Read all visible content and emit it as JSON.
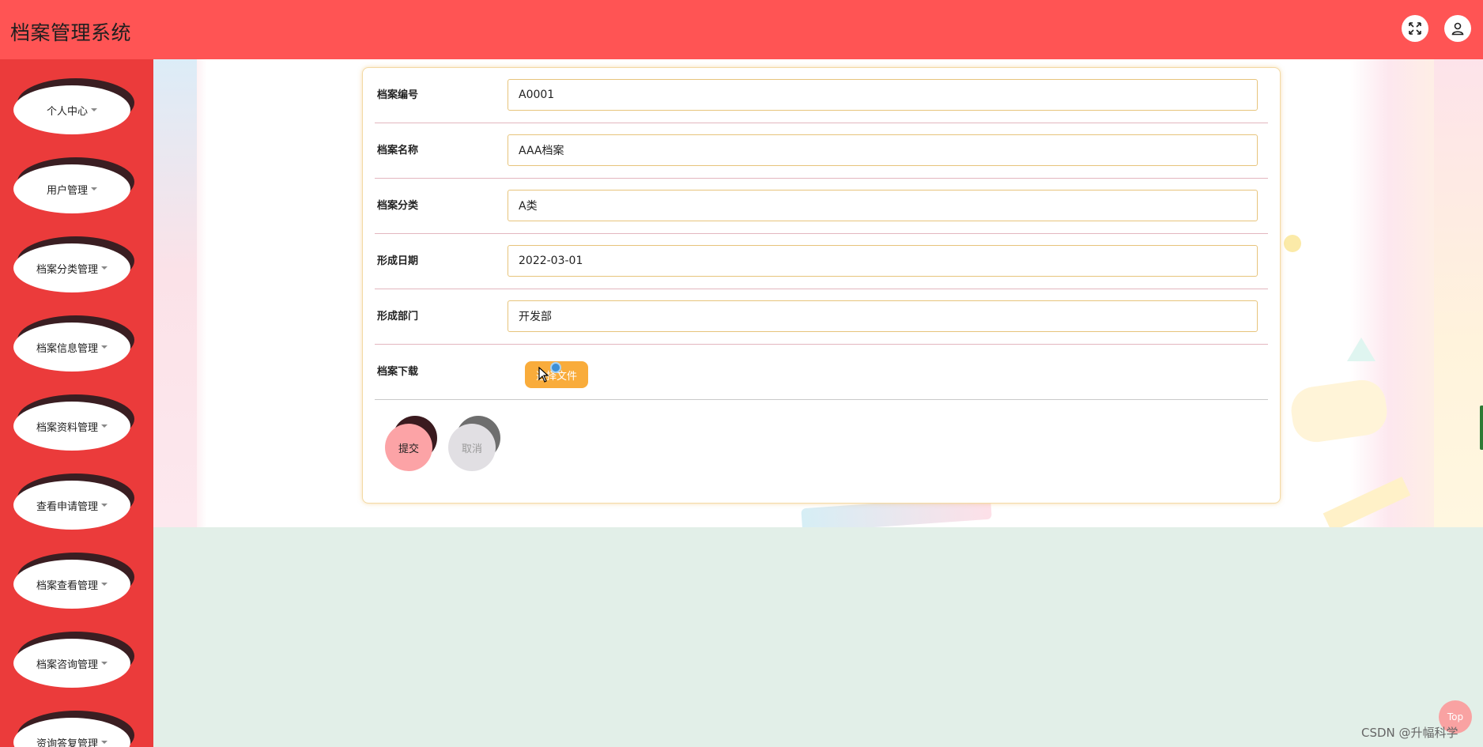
{
  "header": {
    "title": "档案管理系统",
    "icons": [
      "fullscreen-icon",
      "user-icon"
    ]
  },
  "sidebar": {
    "items": [
      {
        "label": "个人中心"
      },
      {
        "label": "用户管理"
      },
      {
        "label": "档案分类管理"
      },
      {
        "label": "档案信息管理"
      },
      {
        "label": "档案资料管理"
      },
      {
        "label": "查看申请管理"
      },
      {
        "label": "档案查看管理"
      },
      {
        "label": "档案咨询管理"
      },
      {
        "label": "资询答复管理"
      }
    ]
  },
  "form": {
    "fields": [
      {
        "label": "档案编号",
        "value": "A0001"
      },
      {
        "label": "档案名称",
        "value": "AAA档案"
      },
      {
        "label": "档案分类",
        "value": "A类"
      },
      {
        "label": "形成日期",
        "value": "2022-03-01"
      },
      {
        "label": "形成部门",
        "value": "开发部"
      }
    ],
    "upload": {
      "label": "档案下载",
      "button_label": "选择文件"
    },
    "submit_label": "提交",
    "cancel_label": "取消"
  },
  "back_to_top": "Top",
  "watermark": "CSDN @升幅科学",
  "colors": {
    "header": "#ff5454",
    "sidebar": "#eb3b3b",
    "upload_button": "#f9ac3b",
    "submit_button": "#fca3a6",
    "page_bg": "#e2efe8"
  }
}
